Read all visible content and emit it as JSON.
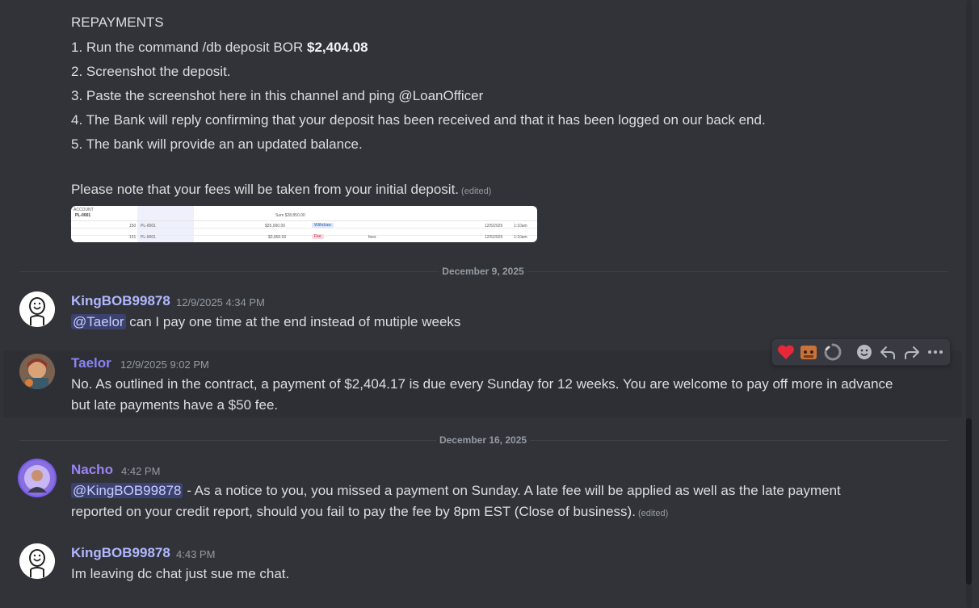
{
  "repayment_message": {
    "title": "REPAYMENTS",
    "step1_prefix": "1. Run the command /db deposit BOR ",
    "step1_amount": "$2,404.08",
    "step2": "2. Screenshot the deposit.",
    "step3": "3. Paste the screenshot here in this channel and ping @LoanOfficer",
    "step4": "4. The Bank will reply confirming that your deposit has been received and that it has been logged on our back end.",
    "step5": "5. The bank will provide an an updated balance.",
    "note": "Please note that your fees will be taken from your initial deposit.",
    "edited_label": "(edited)"
  },
  "attachment": {
    "header_label": "ACCOUNT",
    "account_id": "PL-0001",
    "sum_label": "Sum $28,850.00",
    "rows": [
      {
        "num": "150",
        "id": "PL-0001",
        "amount": "$25,000.00",
        "type": "Withdraw",
        "note": "",
        "date": "12/5/2025",
        "time": "1:10am"
      },
      {
        "num": "151",
        "id": "PL-0001",
        "amount": "$3,850.00",
        "type": "Fee",
        "note": "fees",
        "date": "12/5/2025",
        "time": "1:10am"
      }
    ]
  },
  "date_dividers": [
    "December 9, 2025",
    "December 16, 2025"
  ],
  "messages": [
    {
      "author": "KingBOB99878",
      "author_color": "#b2b8ff",
      "timestamp": "12/9/2025 4:34 PM",
      "mention": "@Taelor",
      "text": " can I pay one time at the end instead of mutiple weeks"
    },
    {
      "author": "Taelor",
      "author_color": "#8a84f4",
      "timestamp": "12/9/2025 9:02 PM",
      "line1": "No. As outlined in the contract, a payment of $2,404.17 is due every Sunday for 12 weeks. You are welcome to pay off more in advance",
      "line2": "but late payments have a $50 fee."
    },
    {
      "author": "Nacho",
      "author_color": "#9b84f4",
      "timestamp": "4:42 PM",
      "mention": "@KingBOB99878",
      "line1": " - As a notice to you, you missed a payment on Sunday. A late fee will be applied as well as the late payment",
      "line2": "reported on your credit report, should you fail to pay the fee by 8pm EST (Close of business).",
      "edited_label": "(edited)"
    },
    {
      "author": "KingBOB99878",
      "author_color": "#b2b8ff",
      "timestamp": "4:43 PM",
      "text": "Im leaving dc chat just sue me chat."
    }
  ],
  "toolbar": {
    "icons": [
      "heart-reaction-icon",
      "cat-reaction-icon",
      "loading-reaction-icon",
      "add-reaction-icon",
      "reply-icon",
      "forward-icon",
      "more-icon"
    ]
  }
}
